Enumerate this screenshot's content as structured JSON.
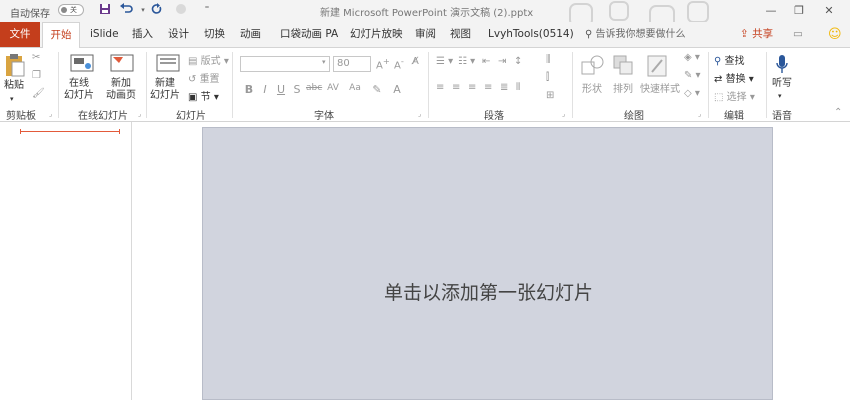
{
  "titlebar": {
    "autosave_label": "自动保存",
    "autosave_state": "关",
    "doc_title": "新建 Microsoft PowerPoint 演示文稿 (2).pptx"
  },
  "tabs": [
    {
      "label": "文件"
    },
    {
      "label": "开始"
    },
    {
      "label": "iSlide"
    },
    {
      "label": "插入"
    },
    {
      "label": "设计"
    },
    {
      "label": "切换"
    },
    {
      "label": "动画"
    },
    {
      "label": "口袋动画 PA"
    },
    {
      "label": "幻灯片放映"
    },
    {
      "label": "审阅"
    },
    {
      "label": "视图"
    },
    {
      "label": "LvyhTools(0514)"
    }
  ],
  "tellme_placeholder": "告诉我你想要做什么",
  "share_label": "共享",
  "ribbon": {
    "clipboard": {
      "label": "剪贴板",
      "paste": "粘贴"
    },
    "online": {
      "label": "在线幻灯片",
      "btn1": "在线\n幻灯片",
      "btn2": "新加\n动画页"
    },
    "slides": {
      "label": "幻灯片",
      "new": "新建\n幻灯片",
      "layout": "版式",
      "reset": "重置",
      "section": "节"
    },
    "font": {
      "label": "字体",
      "size": "80"
    },
    "paragraph": {
      "label": "段落"
    },
    "drawing": {
      "label": "绘图",
      "shapes": "形状",
      "arrange": "排列",
      "quickstyles": "快速样式"
    },
    "editing": {
      "label": "编辑",
      "find": "查找",
      "replace": "替换",
      "select": "选择"
    },
    "voice": {
      "label": "语音",
      "dictate": "听写"
    }
  },
  "slide": {
    "prompt": "单击以添加第一张幻灯片"
  },
  "colors": {
    "accent": "#c43e1c",
    "slide_bg": "#d1d4de"
  }
}
